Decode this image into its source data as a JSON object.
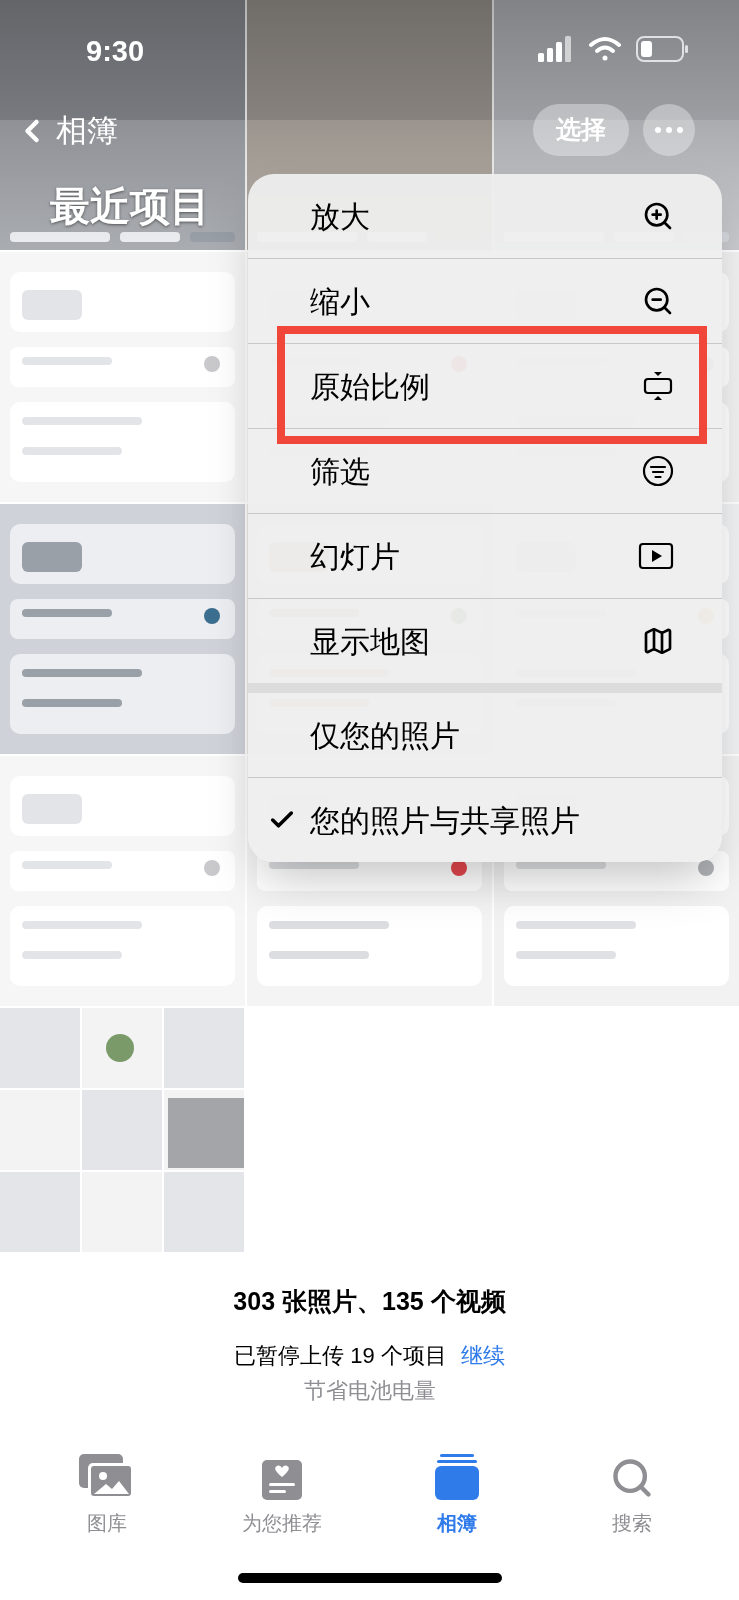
{
  "status_bar": {
    "time": "9:30"
  },
  "nav": {
    "back_label": "相簿",
    "title": "最近项目",
    "select_button": "选择"
  },
  "menu": {
    "groups": [
      {
        "items": [
          {
            "label": "放大",
            "kind": "zoom_in",
            "annotated": false
          },
          {
            "label": "缩小",
            "kind": "zoom_out",
            "annotated": false
          },
          {
            "label": "原始比例",
            "kind": "aspect",
            "annotated": true
          },
          {
            "label": "筛选",
            "kind": "filter",
            "annotated": false
          },
          {
            "label": "幻灯片",
            "kind": "slideshow",
            "annotated": false
          },
          {
            "label": "显示地图",
            "kind": "map",
            "annotated": false
          }
        ]
      },
      {
        "items": [
          {
            "label": "仅您的照片",
            "kind": "option",
            "checked": false
          },
          {
            "label": "您的照片与共享照片",
            "kind": "option",
            "checked": true
          }
        ]
      }
    ]
  },
  "summary": {
    "counts": "303 张照片、135 个视频",
    "upload_status": "已暂停上传 19 个项目",
    "resume_link": "继续",
    "reason": "节省电池电量"
  },
  "tab_bar": [
    {
      "label": "图库",
      "kind": "library",
      "selected": false
    },
    {
      "label": "为您推荐",
      "kind": "for_you",
      "selected": false
    },
    {
      "label": "相簿",
      "kind": "albums",
      "selected": true
    },
    {
      "label": "搜索",
      "kind": "search",
      "selected": false
    }
  ]
}
